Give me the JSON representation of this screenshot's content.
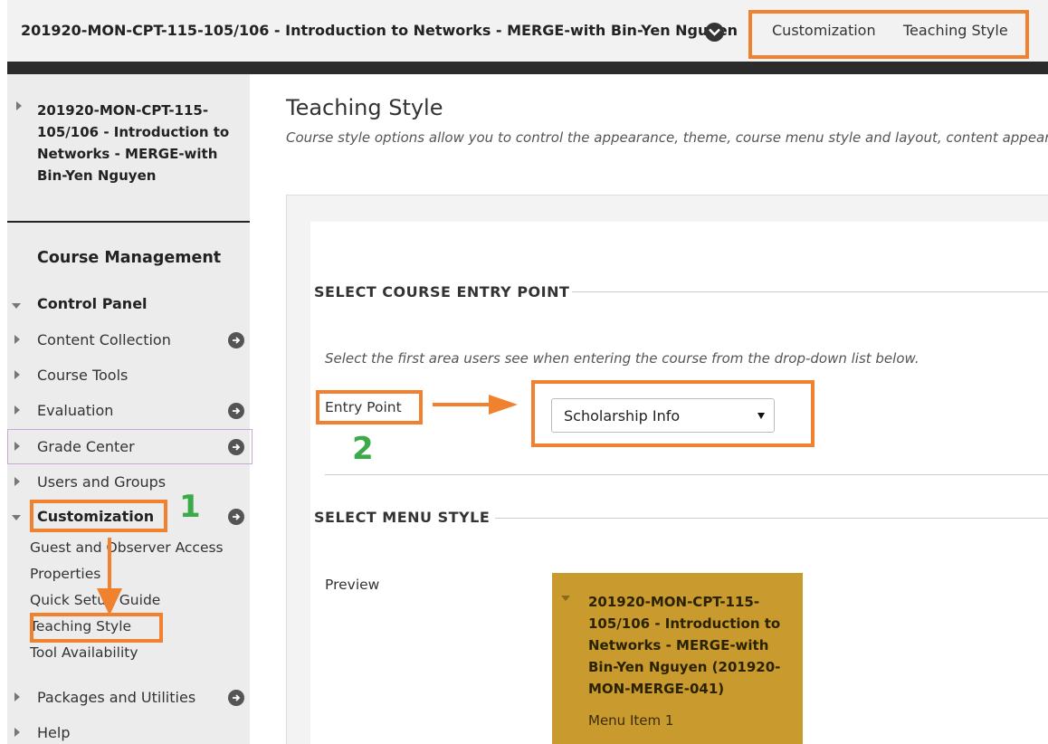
{
  "header": {
    "course_title": "201920-MON-CPT-115-105/106 - Introduction to Networks - MERGE-with Bin-Yen Nguyen",
    "breadcrumbs": [
      "Customization",
      "Teaching Style"
    ]
  },
  "sidebar": {
    "course_lines": [
      "201920-MON-CPT-115-",
      "105/106 - Introduction to",
      "Networks - MERGE-with",
      "Bin-Yen Nguyen"
    ],
    "course_management": "Course Management",
    "control_panel": "Control Panel",
    "items": [
      {
        "label": "Content Collection"
      },
      {
        "label": "Course Tools"
      },
      {
        "label": "Evaluation"
      },
      {
        "label": "Grade Center"
      },
      {
        "label": "Users and Groups"
      },
      {
        "label": "Customization"
      },
      {
        "label": "Packages and Utilities"
      },
      {
        "label": "Help"
      }
    ],
    "customization_sub": [
      "Guest and Observer Access",
      "Properties",
      "Quick Setup Guide",
      "Teaching Style",
      "Tool Availability"
    ]
  },
  "annotations": {
    "step1": "1",
    "step2": "2"
  },
  "main": {
    "title": "Teaching Style",
    "description": "Course style options allow you to control the appearance, theme, course menu style and layout, content appearance",
    "entry_section": "SELECT COURSE ENTRY POINT",
    "instruction": "Select the first area users see when entering the course from the drop-down list below.",
    "entry_label": "Entry Point",
    "entry_value": "Scholarship Info",
    "menu_section": "SELECT MENU STYLE",
    "preview_label": "Preview",
    "preview_lines": [
      "201920-MON-CPT-115-",
      "105/106 - Introduction to",
      "Networks - MERGE-with",
      "Bin-Yen Nguyen (201920-",
      "MON-MERGE-041)"
    ],
    "preview_item": "Menu Item 1"
  },
  "colors": {
    "annotation_orange": "#f0822f",
    "annotation_green": "#3daa4a",
    "preview_bg": "#c99a2e"
  }
}
